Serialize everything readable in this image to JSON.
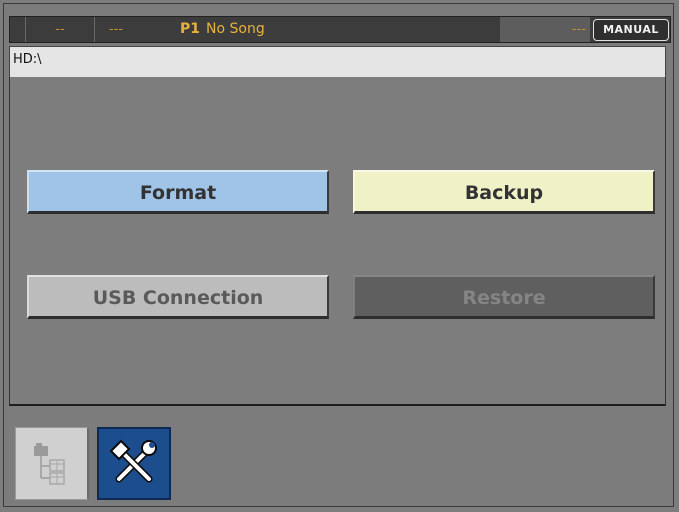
{
  "status_bar": {
    "slot1": "--",
    "slot2": "---",
    "program_id": "P1",
    "song_name": "No Song",
    "slot3": "---",
    "mode": "MANUAL"
  },
  "path": "HD:\\",
  "buttons": {
    "format": "Format",
    "backup": "Backup",
    "usb_connection": "USB Connection",
    "restore": "Restore"
  },
  "tabs": [
    {
      "icon": "file-browser-icon",
      "selected": false
    },
    {
      "icon": "tools-icon",
      "selected": true
    }
  ]
}
